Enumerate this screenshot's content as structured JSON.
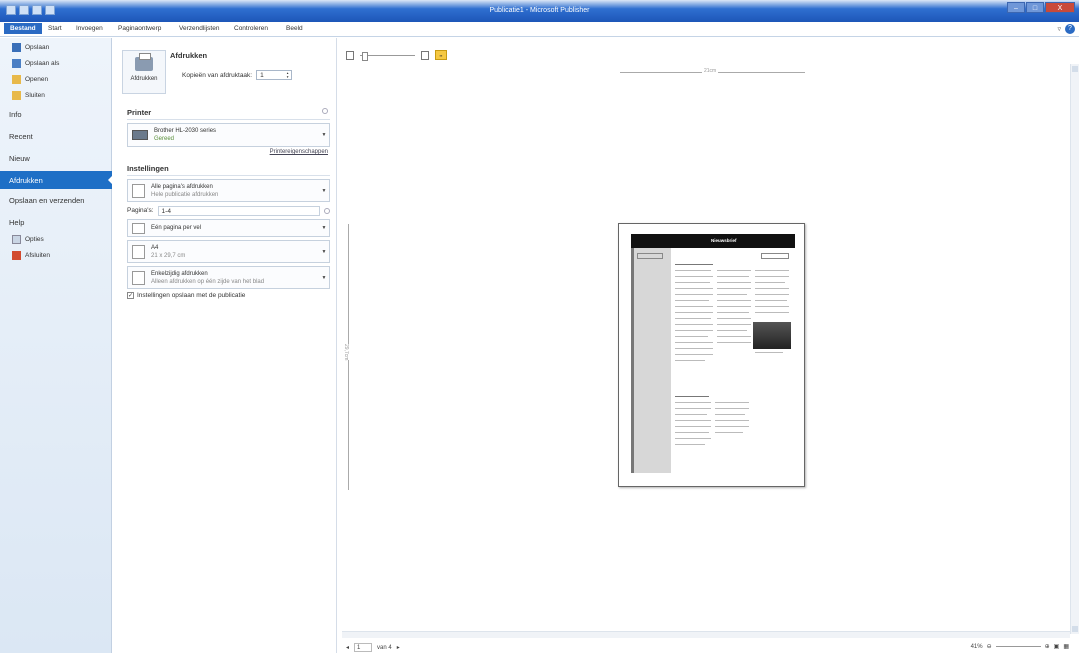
{
  "window": {
    "title": "Publicatie1 - Microsoft Publisher",
    "buttons": [
      "–",
      "□",
      "X"
    ]
  },
  "ribbon": {
    "tabs": [
      "Bestand",
      "Start",
      "Invoegen",
      "Paginaontwerp",
      "Verzendlijsten",
      "Controleren",
      "Beeld"
    ]
  },
  "nav": {
    "save": "Opslaan",
    "save_as": "Opslaan als",
    "open": "Openen",
    "close": "Sluiten",
    "info": "Info",
    "recent": "Recent",
    "new": "Nieuw",
    "print": "Afdrukken",
    "save_send": "Opslaan en verzenden",
    "help": "Help",
    "options": "Opties",
    "exit": "Afsluiten"
  },
  "print": {
    "header": "Afdrukken",
    "button_label": "Afdrukken",
    "copies_label": "Kopieën van afdruktaak:",
    "copies_value": "1",
    "printer_section": "Printer",
    "printer_name": "Brother HL-2030 series",
    "printer_status": "Gereed",
    "printer_props": "Printereigenschappen",
    "settings_section": "Instellingen",
    "pages_option": "Alle pagina's afdrukken",
    "pages_option_sub": "Hele publicatie afdrukken",
    "pages_label": "Pagina's:",
    "pages_value": "1-4",
    "layout_option": "Eén pagina per vel",
    "paper_option": "A4",
    "paper_sub": "21 x 29,7 cm",
    "sides_option": "Enkelzijdig afdrukken",
    "sides_sub": "Alleen afdrukken op één zijde van het blad",
    "save_settings": "Instellingen opslaan met de publicatie"
  },
  "preview": {
    "ruler_h": "21cm",
    "ruler_v": "29,7cm",
    "page_heading": "Nieuwsbrief",
    "current_page": "1",
    "page_total": "van 4",
    "zoom": "41%"
  }
}
